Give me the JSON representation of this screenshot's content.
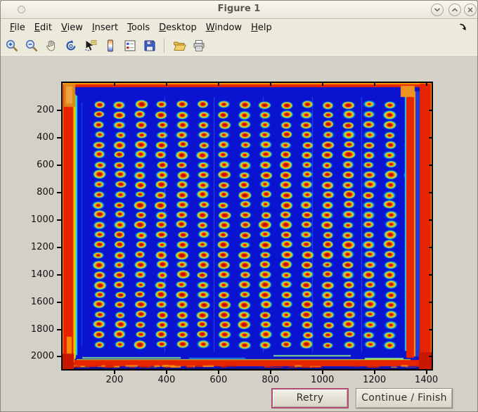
{
  "window": {
    "title": "Figure 1",
    "controls": {
      "minimize": "chevron-down",
      "maximize": "chevron-up",
      "close": "x"
    }
  },
  "menu_bar": {
    "items": [
      {
        "label": "File"
      },
      {
        "label": "Edit"
      },
      {
        "label": "View"
      },
      {
        "label": "Insert"
      },
      {
        "label": "Tools"
      },
      {
        "label": "Desktop"
      },
      {
        "label": "Window"
      },
      {
        "label": "Help"
      }
    ]
  },
  "toolbar": {
    "icons": [
      "zoom-in",
      "zoom-out",
      "pan",
      "rotate-3d",
      "data-cursor",
      "insert-colorbar",
      "insert-legend",
      "save-figure",
      "open-file",
      "print-figure"
    ]
  },
  "action_bar": {
    "retry_label": "Retry",
    "continue_label": "Continue / Finish"
  },
  "chart_data": {
    "type": "heatmap",
    "title": "",
    "xlabel": "",
    "ylabel": "",
    "colormap": "jet",
    "content": "Scanned microplate / spot-array image: grid of warm (red-center, yellow-ring, cyan-halo) spots on deep blue background with saturated red border bands along all four image edges",
    "x_ticks": [
      200,
      400,
      600,
      800,
      1000,
      1200,
      1400
    ],
    "y_ticks": [
      200,
      400,
      600,
      800,
      1000,
      1200,
      1400,
      1600,
      1800,
      2000
    ],
    "x_range": [
      0,
      1420
    ],
    "y_range": [
      0,
      2090
    ],
    "grid_on": false,
    "legend": "none",
    "spot_grid": {
      "rows": 25,
      "cols": 16,
      "first_x": 141,
      "first_y": 160,
      "pitch_x": 80,
      "pitch_y": 73
    },
    "colors": {
      "background": "#0a14d0",
      "border_red": "#e62400",
      "border_orange": "#ff9a00",
      "spot_center": "#d51a00",
      "spot_ring": "#ffd800",
      "spot_halo": "#1fc8ea"
    }
  }
}
